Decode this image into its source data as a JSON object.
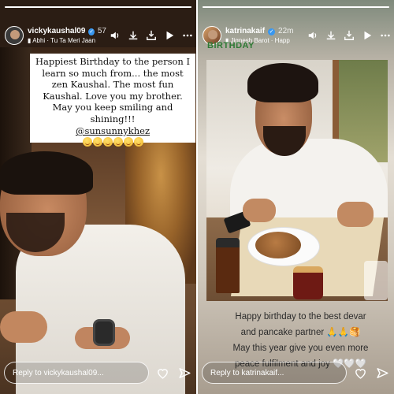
{
  "left_story": {
    "username": "vickykaushal09",
    "time": "57",
    "music": "Abhi · Tu Ta Meri Jaan",
    "progress": 1.0,
    "caption": "Happiest Birthday to the person I learn so much from... the most zen Kaushal. The most fun Kaushal. Love you my brother. May you keep smiling and shining!!!",
    "mention": "@sunsunnykhez",
    "reply_placeholder": "Reply to vickykaushal09..."
  },
  "right_story": {
    "username": "katrinakaif",
    "time": "22m",
    "music": "Jignesh Barot · Happ",
    "progress": 1.0,
    "sticker": "BIRTHDAY",
    "caption_lines": [
      "Happy birthday to the best devar",
      "and pancake partner 🙏🙏🥞",
      "May this year give you even more",
      "peace fulfilment and joy 🤍🤍🤍"
    ],
    "reply_placeholder": "Reply to katrinakaif..."
  },
  "icons": {
    "verified": "✓"
  }
}
